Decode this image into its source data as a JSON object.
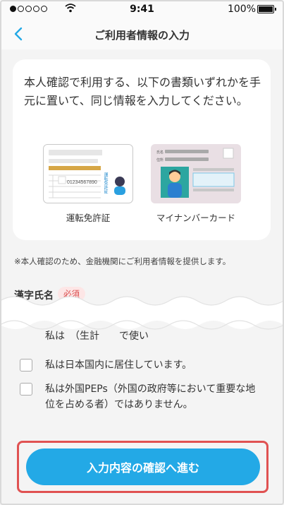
{
  "status_bar": {
    "time": "9:41",
    "battery": "100%"
  },
  "nav": {
    "title": "ご利用者情報の入力",
    "back_icon": "chevron-left-icon"
  },
  "info": {
    "text": "本人確認で利用する、以下の書類いずれかを手元に置いて、同じ情報を入力してください。",
    "documents": [
      {
        "caption": "運転免許証",
        "license_number": "01234567890",
        "vertical_label": "運転免許証"
      },
      {
        "caption": "マイナンバーカード",
        "field_name": "氏名",
        "field_address": "住所"
      }
    ]
  },
  "notice": "※本人確認のため、金融機関にご利用者情報を提供します。",
  "name_field": {
    "label": "漢字氏名",
    "required_badge": "必須"
  },
  "checkboxes": [
    {
      "label": "私は日本国内に居住しています。",
      "checked": false
    },
    {
      "label": "私は外国PEPs（外国の政府等において重要な地位を占める者）ではありません。",
      "checked": false
    }
  ],
  "partial_text": "私は",
  "partial_text_2": "（生計",
  "partial_text_3": "で使い",
  "submit_label": "入力内容の確認へ進む",
  "colors": {
    "accent": "#23a9e6",
    "highlight_outline": "#e05252",
    "required_badge": "#d94a4a"
  }
}
